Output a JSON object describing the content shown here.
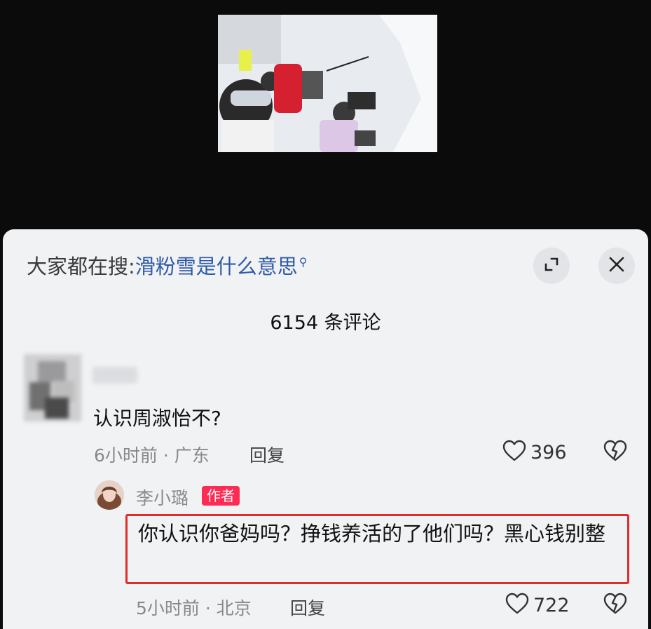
{
  "search_hint": {
    "prefix": "大家都在搜:",
    "term": "滑粉雪是什么意思",
    "icon": "search-icon"
  },
  "header_icons": {
    "expand": "expand-icon",
    "close": "close-icon"
  },
  "comment_count": "6154 条评论",
  "comments": [
    {
      "text": "认识周淑怡不?",
      "meta": "6小时前 · 广东",
      "reply_label": "回复",
      "likes": "396"
    }
  ],
  "reply": {
    "username": "李小璐",
    "badge": "作者",
    "text": "你认识你爸妈吗？挣钱养活的了他们吗？黑心钱别整",
    "meta": "5小时前 · 北京",
    "reply_label": "回复",
    "likes": "722"
  },
  "colors": {
    "accent_term": "#2f5aa8",
    "badge": "#fe2c55",
    "highlight_box": "#e02c2c",
    "sheet_bg": "#f1f2f4"
  }
}
